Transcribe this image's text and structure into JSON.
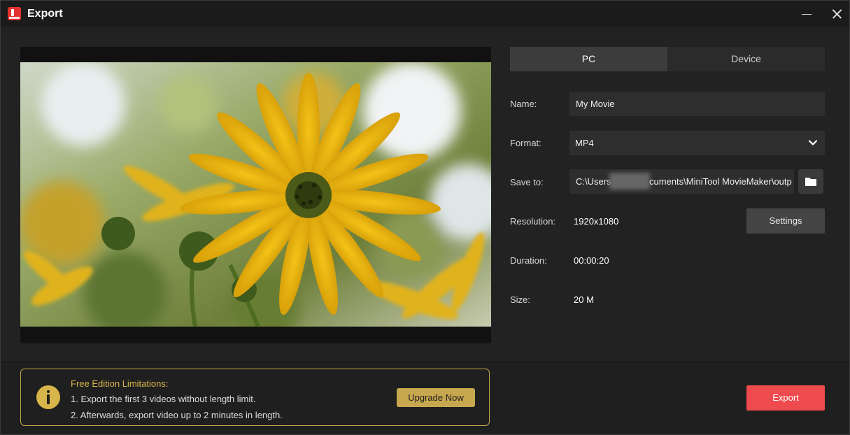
{
  "window": {
    "title": "Export",
    "logo_icon": "minitool-moviemaker-logo",
    "minimize_icon": "minimize-icon",
    "close_icon": "close-icon"
  },
  "preview": {
    "description_icon": "video-preview-frame"
  },
  "tabs": [
    {
      "label": "PC",
      "active": true
    },
    {
      "label": "Device",
      "active": false
    }
  ],
  "form": {
    "name_label": "Name:",
    "name_value": "My Movie",
    "format_label": "Format:",
    "format_value": "MP4",
    "save_to_label": "Save to:",
    "save_to_prefix": "C:\\Users",
    "save_to_suffix": "cuments\\MiniTool MovieMaker\\outp",
    "folder_icon": "folder-icon",
    "resolution_label": "Resolution:",
    "resolution_value": "1920x1080",
    "settings_label": "Settings",
    "duration_label": "Duration:",
    "duration_value": "00:00:20",
    "size_label": "Size:",
    "size_value": "20 M"
  },
  "notice": {
    "icon": "info-icon",
    "title": "Free Edition Limitations:",
    "line1": "1. Export the first 3 videos without length limit.",
    "line2": "2. Afterwards, export video up to 2 minutes in length.",
    "upgrade_label": "Upgrade Now"
  },
  "footer": {
    "export_label": "Export"
  },
  "colors": {
    "accent_red": "#ef4a4e",
    "gold": "#c8a84e",
    "background": "#222222"
  }
}
